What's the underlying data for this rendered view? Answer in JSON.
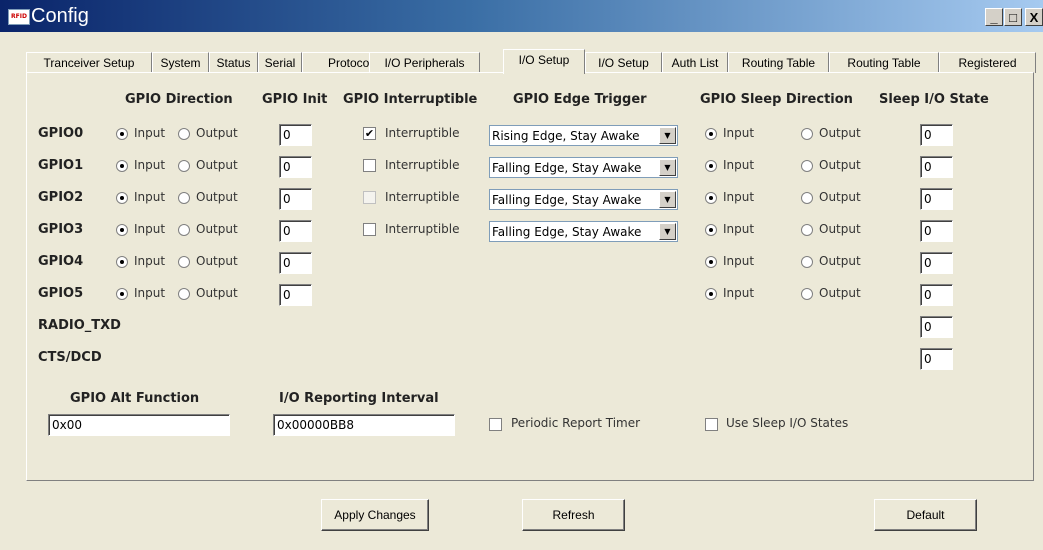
{
  "window": {
    "title": "Config",
    "app_icon_text": "RFID",
    "minimize_label": "_",
    "maximize_label": "□",
    "close_label": "X"
  },
  "tabs": [
    {
      "label": "Tranceiver Setup",
      "active": false
    },
    {
      "label": "System",
      "active": false
    },
    {
      "label": "Status",
      "active": false
    },
    {
      "label": "Serial",
      "active": false
    },
    {
      "label": "Protocol",
      "active": false
    },
    {
      "label": "I/O Peripherals",
      "active": false
    },
    {
      "label": "I/O Setup",
      "active": true
    },
    {
      "label": "I/O Setup",
      "active": false
    },
    {
      "label": "Auth List",
      "active": false
    },
    {
      "label": "Routing Table",
      "active": false
    },
    {
      "label": "Routing Table",
      "active": false
    },
    {
      "label": "Registered",
      "active": false
    }
  ],
  "headers": {
    "direction": "GPIO Direction",
    "init": "GPIO Init",
    "interruptible": "GPIO Interruptible",
    "edge": "GPIO Edge Trigger",
    "sleep_dir": "GPIO Sleep Direction",
    "sleep_state": "Sleep I/O State"
  },
  "labels": {
    "input": "Input",
    "output": "Output",
    "interruptible": "Interruptible"
  },
  "gpio_rows": [
    {
      "name": "GPIO0",
      "direction": "Input",
      "init": "0",
      "interruptible": true,
      "interruptible_enabled": true,
      "edge": "Rising Edge, Stay Awake",
      "sleep_direction": "Input",
      "sleep_state": "0"
    },
    {
      "name": "GPIO1",
      "direction": "Input",
      "init": "0",
      "interruptible": false,
      "interruptible_enabled": true,
      "edge": "Falling Edge, Stay Awake",
      "sleep_direction": "Input",
      "sleep_state": "0"
    },
    {
      "name": "GPIO2",
      "direction": "Input",
      "init": "0",
      "interruptible": false,
      "interruptible_enabled": false,
      "edge": "Falling Edge, Stay Awake",
      "sleep_direction": "Input",
      "sleep_state": "0"
    },
    {
      "name": "GPIO3",
      "direction": "Input",
      "init": "0",
      "interruptible": false,
      "interruptible_enabled": true,
      "edge": "Falling Edge, Stay Awake",
      "sleep_direction": "Input",
      "sleep_state": "0"
    },
    {
      "name": "GPIO4",
      "direction": "Input",
      "init": "0",
      "sleep_direction": "Input",
      "sleep_state": "0"
    },
    {
      "name": "GPIO5",
      "direction": "Input",
      "init": "0",
      "sleep_direction": "Input",
      "sleep_state": "0"
    }
  ],
  "extra_rows": [
    {
      "name": "RADIO_TXD",
      "sleep_state": "0"
    },
    {
      "name": "CTS/DCD",
      "sleep_state": "0"
    }
  ],
  "alt_function": {
    "label": "GPIO Alt Function",
    "value": "0x00"
  },
  "reporting_interval": {
    "label": "I/O Reporting Interval",
    "value": "0x00000BB8"
  },
  "periodic_report_timer": {
    "label": "Periodic Report Timer",
    "checked": false
  },
  "use_sleep_states": {
    "label": "Use Sleep I/O States",
    "checked": false
  },
  "buttons": {
    "apply": "Apply Changes",
    "refresh": "Refresh",
    "default": "Default"
  }
}
